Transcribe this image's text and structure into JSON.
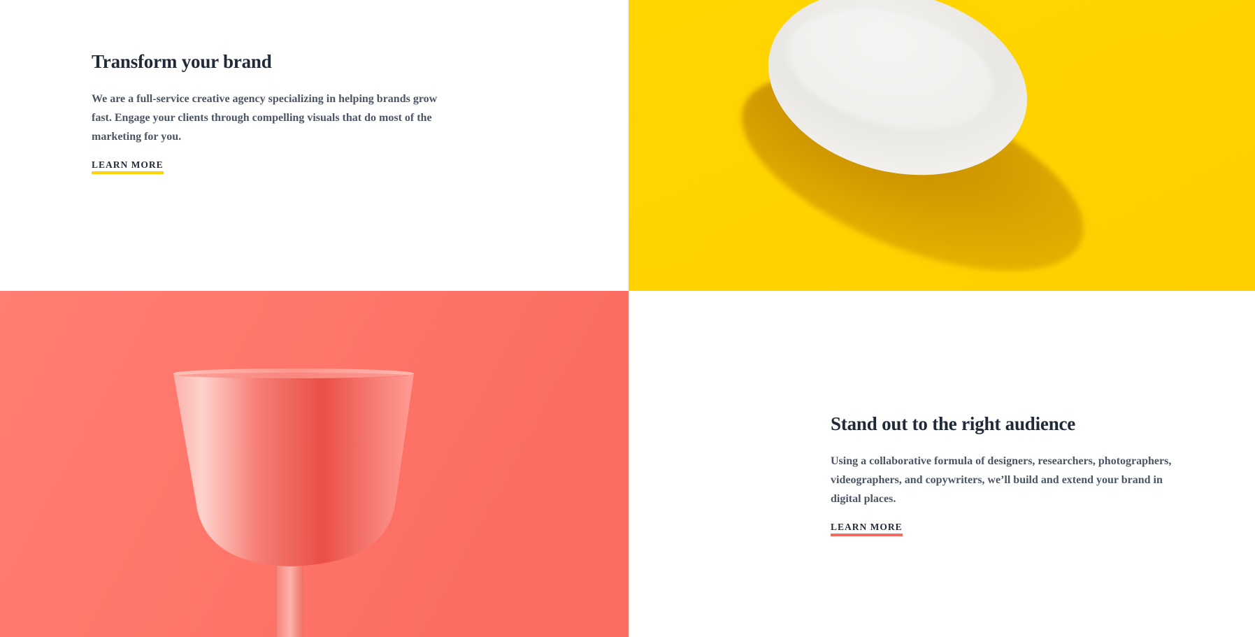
{
  "features": [
    {
      "title": "Transform your brand",
      "description": "We are a full-service creative agency specializing in helping brands grow fast. Engage your clients through compelling visuals that do most of the marketing for you.",
      "cta_label": "LEARN MORE",
      "accent_color": "#ffd203",
      "image_subject": "egg-on-yellow"
    },
    {
      "title": "Stand out to the right audience",
      "description": "Using a collaborative formula of designers, researchers, photographers, videographers, and copywriters, we’ll build and extend your brand in digital places.",
      "cta_label": "LEARN MORE",
      "accent_color": "#f36b62",
      "image_subject": "glass-on-coral"
    }
  ],
  "colors": {
    "yellow_background": "#ffd203",
    "coral_background": "#fb6f63",
    "heading_text": "#1f2937",
    "body_text": "#4b5563"
  }
}
